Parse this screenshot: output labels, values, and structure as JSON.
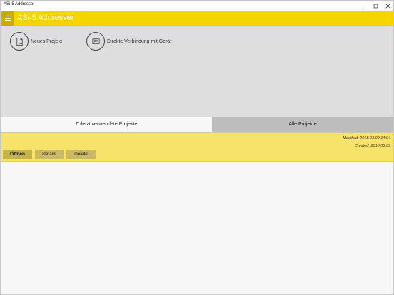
{
  "window": {
    "title": "ASi-5 Addresser"
  },
  "appbar": {
    "title": "ASi-5 Addresser"
  },
  "actions": [
    {
      "label": "Neues Projekt",
      "icon": "new-document-icon"
    },
    {
      "label": "Direkte Verbindung mit Gerät",
      "icon": "device-connection-icon"
    }
  ],
  "tabs": [
    {
      "label": "Zuletzt verwendete Projekte",
      "active": true
    },
    {
      "label": "Alle Projekte",
      "active": false
    }
  ],
  "project": {
    "modified": "Modified: 2018.03.09 14:04",
    "created": "Created: 2018.03.09",
    "buttons": {
      "open": "Öffnen",
      "details": "Details",
      "delete": "Delete"
    }
  },
  "colors": {
    "accent": "#f5d400",
    "accent_dark": "#c9ad00",
    "card": "#f7e36a",
    "panel": "#dedede"
  }
}
